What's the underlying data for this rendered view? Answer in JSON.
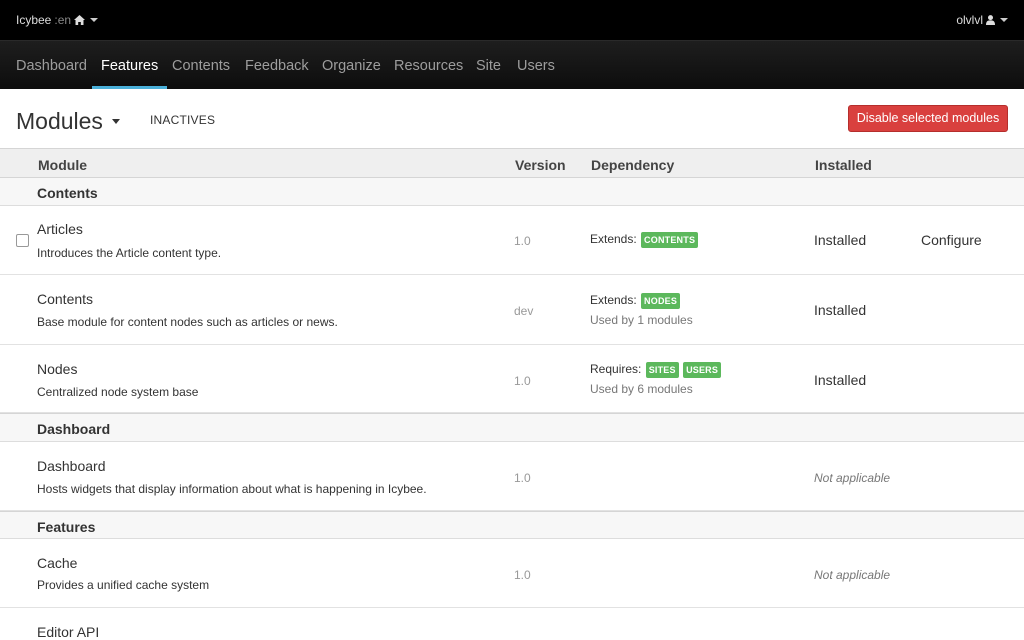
{
  "topbar": {
    "site_name": "Icybee",
    "site_lang": ":en",
    "user_name": "olvlvl"
  },
  "nav": {
    "items": [
      {
        "label": "Dashboard"
      },
      {
        "label": "Features"
      },
      {
        "label": "Contents"
      },
      {
        "label": "Feedback"
      },
      {
        "label": "Organize"
      },
      {
        "label": "Resources"
      },
      {
        "label": "Site"
      },
      {
        "label": "Users"
      }
    ],
    "active": "Features"
  },
  "header": {
    "title": "Modules",
    "inactives_label": "INACTIVES",
    "disable_button": "Disable selected modules"
  },
  "table": {
    "columns": {
      "module": "Module",
      "version": "Version",
      "dependency": "Dependency",
      "installed": "Installed"
    },
    "groups": [
      {
        "name": "Contents",
        "rows": [
          {
            "name": "Articles",
            "description": "Introduces the Article content type.",
            "version": "1.0",
            "dep_label": "Extends:",
            "badges": [
              "CONTENTS"
            ],
            "used_by": "",
            "status": "Installed",
            "action": "Configure"
          },
          {
            "name": "Contents",
            "description": "Base module for content nodes such as articles or news.",
            "version": "dev",
            "dep_label": "Extends:",
            "badges": [
              "NODES"
            ],
            "used_by": "Used by 1 modules",
            "status": "Installed",
            "action": ""
          },
          {
            "name": "Nodes",
            "description": "Centralized node system base",
            "version": "1.0",
            "dep_label": "Requires:",
            "badges": [
              "SITES",
              "USERS"
            ],
            "used_by": "Used by 6 modules",
            "status": "Installed",
            "action": ""
          }
        ]
      },
      {
        "name": "Dashboard",
        "rows": [
          {
            "name": "Dashboard",
            "description": "Hosts widgets that display information about what is happening in Icybee.",
            "version": "1.0",
            "status": "Not applicable"
          }
        ]
      },
      {
        "name": "Features",
        "rows": [
          {
            "name": "Cache",
            "description": "Provides a unified cache system",
            "version": "1.0",
            "status": "Not applicable"
          },
          {
            "name": "Editor API"
          }
        ]
      }
    ]
  },
  "colors": {
    "accent": "#4ab0d9",
    "danger": "#d9403e",
    "badge": "#5cb85c"
  },
  "icons": {
    "home": "home-icon",
    "user": "user-icon"
  }
}
